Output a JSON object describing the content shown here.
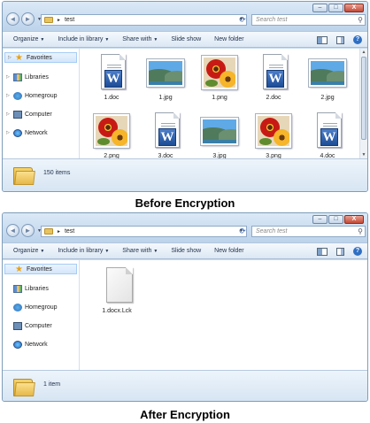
{
  "before": {
    "caption_buttons": [
      "–",
      "□",
      "X"
    ],
    "nav_arrows": [
      "◄",
      "►"
    ],
    "path": "test",
    "search_placeholder": "Search test",
    "toolbar": [
      "Organize",
      "Include in library",
      "Share with",
      "Slide show",
      "New folder"
    ],
    "nav": [
      "Favorites",
      "Libraries",
      "Homegroup",
      "Computer",
      "Network"
    ],
    "files": [
      {
        "name": "1.doc",
        "kind": "doc"
      },
      {
        "name": "1.jpg",
        "kind": "jpg"
      },
      {
        "name": "1.png",
        "kind": "png"
      },
      {
        "name": "2.doc",
        "kind": "doc"
      },
      {
        "name": "2.jpg",
        "kind": "jpg"
      },
      {
        "name": "2.png",
        "kind": "png"
      },
      {
        "name": "3.doc",
        "kind": "doc"
      },
      {
        "name": "3.jpg",
        "kind": "jpg"
      },
      {
        "name": "3.png",
        "kind": "png"
      },
      {
        "name": "4.doc",
        "kind": "doc"
      }
    ],
    "status": "150 items",
    "heading": "Before Encryption"
  },
  "after": {
    "caption_buttons": [
      "–",
      "□",
      "X"
    ],
    "nav_arrows": [
      "◄",
      "►"
    ],
    "path": "test",
    "search_placeholder": "Search test",
    "toolbar": [
      "Organize",
      "Include in library",
      "Share with",
      "Slide show",
      "New folder"
    ],
    "nav": [
      "Favorites",
      "Libraries",
      "Homegroup",
      "Computer",
      "Network"
    ],
    "files": [
      {
        "name": "1.docx.Lck",
        "kind": "lck"
      }
    ],
    "status": "1 item",
    "heading": "After Encryption"
  },
  "icons": {
    "favorites": "star-icon",
    "libraries": "library-icon",
    "homegroup": "homegroup-icon",
    "computer": "computer-icon",
    "network": "network-icon",
    "word_badge": "W"
  },
  "colors": {
    "window_frame": "#c9dcef",
    "close_button": "#c44a36",
    "selection": "#d3e6fb"
  }
}
